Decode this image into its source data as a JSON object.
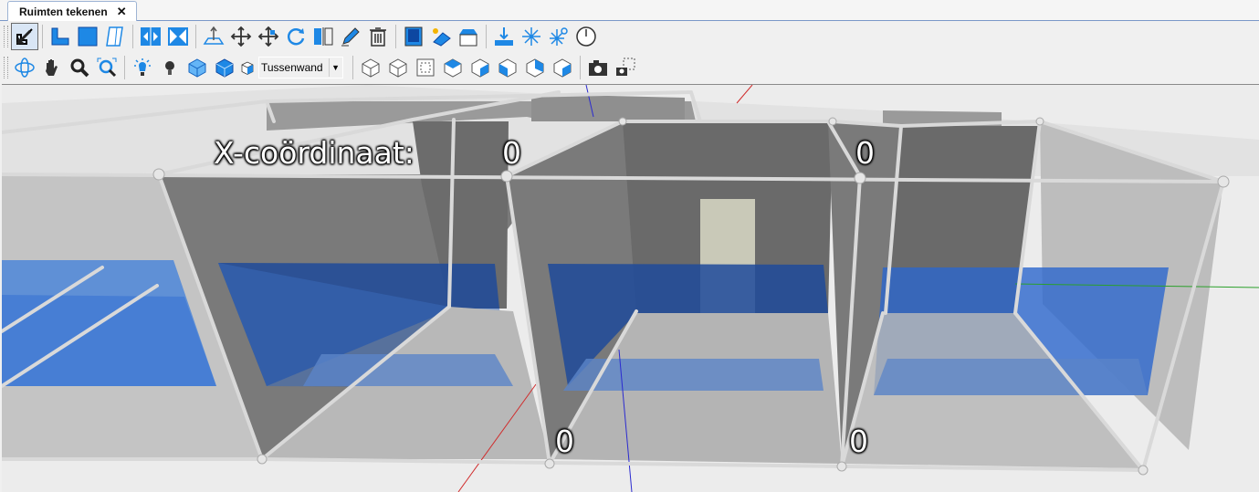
{
  "tab": {
    "label": "Ruimten tekenen",
    "close_glyph": "✕"
  },
  "toolbar": {
    "dropdown_value": "Tussenwand",
    "icons_row1": [
      "select-arrow-icon",
      "draw-l-room-icon",
      "draw-rect-room-icon",
      "draw-skew-room-icon",
      "split-horizontal-icon",
      "split-vertical-icon",
      "extrude-icon",
      "move-icon",
      "move-vertex-icon",
      "rotate-icon",
      "wall-split-icon",
      "edit-pencil-icon",
      "delete-icon",
      "window-icon",
      "solar-panel-icon",
      "roof-icon",
      "floor-level-icon",
      "snap-star-icon",
      "snap-point-icon",
      "clock-icon"
    ],
    "icons_row2": [
      "orbit-icon",
      "pan-hand-icon",
      "zoom-icon",
      "zoom-extents-icon",
      "light-sun-icon",
      "bulb-icon",
      "view-box-blue-icon",
      "view-box-blue2-icon",
      "wall-type-icon",
      "view-cube-1-icon",
      "view-cube-2-icon",
      "view-cube-3-icon",
      "view-cube-4-icon",
      "view-cube-5-icon",
      "view-cube-6-icon",
      "view-cube-7-icon",
      "view-cube-8-icon",
      "camera-icon",
      "camera-grid-icon"
    ]
  },
  "viewport": {
    "labels": {
      "x_coordinate_label": "X-coördinaat:",
      "value_top_1": "0",
      "value_top_2": "0",
      "value_bottom_1": "0",
      "value_bottom_2": "0"
    },
    "colors": {
      "wall": "#8a8a8a",
      "glass_blue": "#3b76d8",
      "frame": "#d8d8d8",
      "background": "#ececec"
    }
  }
}
